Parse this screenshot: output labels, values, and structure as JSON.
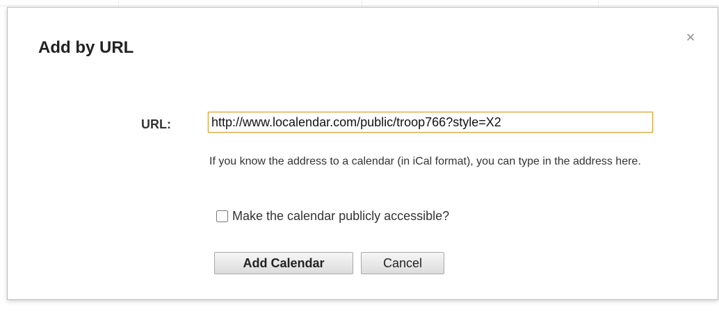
{
  "dialog": {
    "title": "Add by URL",
    "close_symbol": "×",
    "close_icon": "close-icon"
  },
  "form": {
    "url_label": "URL:",
    "url_value": "http://www.localendar.com/public/troop766?style=X2",
    "help_text": "If you know the address to a calendar (in iCal format), you can type in the address here.",
    "public_checkbox_label": "Make the calendar publicly accessible?",
    "public_checked": false
  },
  "buttons": {
    "add_label": "Add Calendar",
    "cancel_label": "Cancel"
  },
  "colors": {
    "focus_border": "#d9a12f",
    "title_text": "#222222"
  }
}
